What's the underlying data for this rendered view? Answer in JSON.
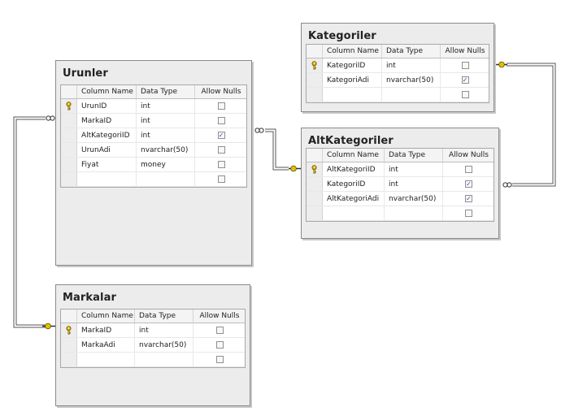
{
  "tables": {
    "urunler": {
      "title": "Urunler",
      "header": [
        "Column Name",
        "Data Type",
        "Allow Nulls"
      ],
      "rows": [
        {
          "name": "UrunID",
          "type": "int",
          "nulls": false,
          "key": true
        },
        {
          "name": "MarkaID",
          "type": "int",
          "nulls": false,
          "key": false
        },
        {
          "name": "AltKategoriID",
          "type": "int",
          "nulls": true,
          "key": false
        },
        {
          "name": "UrunAdi",
          "type": "nvarchar(50)",
          "nulls": false,
          "key": false
        },
        {
          "name": "Fiyat",
          "type": "money",
          "nulls": false,
          "key": false
        },
        {
          "name": "",
          "type": "",
          "nulls": false,
          "key": false
        }
      ]
    },
    "markalar": {
      "title": "Markalar",
      "header": [
        "Column Name",
        "Data Type",
        "Allow Nulls"
      ],
      "rows": [
        {
          "name": "MarkaID",
          "type": "int",
          "nulls": false,
          "key": true
        },
        {
          "name": "MarkaAdi",
          "type": "nvarchar(50)",
          "nulls": false,
          "key": false
        },
        {
          "name": "",
          "type": "",
          "nulls": false,
          "key": false
        }
      ]
    },
    "kategoriler": {
      "title": "Kategoriler",
      "header": [
        "Column Name",
        "Data Type",
        "Allow Nulls"
      ],
      "rows": [
        {
          "name": "KategoriID",
          "type": "int",
          "nulls": false,
          "key": true
        },
        {
          "name": "KategoriAdi",
          "type": "nvarchar(50)",
          "nulls": true,
          "key": false
        },
        {
          "name": "",
          "type": "",
          "nulls": false,
          "key": false
        }
      ]
    },
    "altkategoriler": {
      "title": "AltKategoriler",
      "header": [
        "Column Name",
        "Data Type",
        "Allow Nulls"
      ],
      "rows": [
        {
          "name": "AltKategoriID",
          "type": "int",
          "nulls": false,
          "key": true
        },
        {
          "name": "KategoriID",
          "type": "int",
          "nulls": true,
          "key": false
        },
        {
          "name": "AltKategoriAdi",
          "type": "nvarchar(50)",
          "nulls": true,
          "key": false
        },
        {
          "name": "",
          "type": "",
          "nulls": false,
          "key": false
        }
      ]
    }
  },
  "relationships": [
    {
      "from": "Markalar",
      "to": "Urunler",
      "from_end": "key",
      "to_end": "infinity"
    },
    {
      "from": "AltKategoriler",
      "to": "Urunler",
      "from_end": "key",
      "to_end": "infinity"
    },
    {
      "from": "Kategoriler",
      "to": "AltKategoriler",
      "from_end": "key",
      "to_end": "infinity"
    }
  ],
  "colors": {
    "check": "#3a55b4",
    "key": "#d8b400",
    "link": "#5a5a5a",
    "window_bg": "#ececec"
  }
}
